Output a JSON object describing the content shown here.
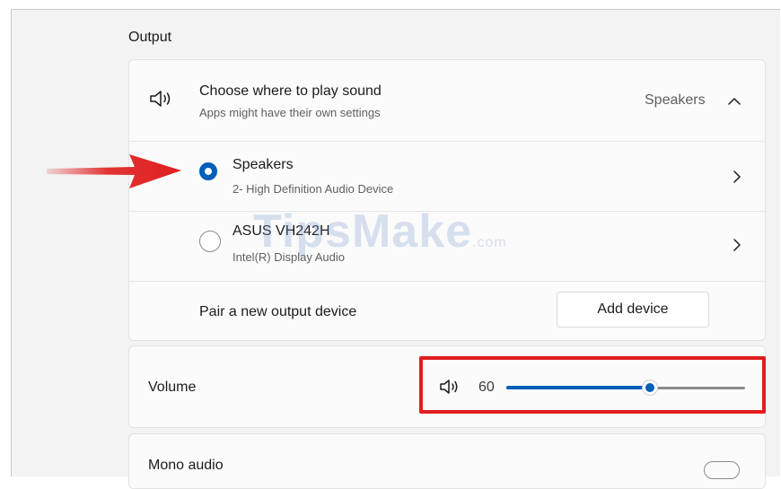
{
  "output": {
    "section_title": "Output",
    "header": {
      "title": "Choose where to play sound",
      "subtitle": "Apps might have their own settings",
      "current_device": "Speakers",
      "icon": "speaker-icon",
      "expand_icon": "chevron-up-icon"
    },
    "devices": [
      {
        "name": "Speakers",
        "description": "2- High Definition Audio Device",
        "selected": true
      },
      {
        "name": "ASUS VH242H",
        "description": "Intel(R) Display Audio",
        "selected": false
      }
    ],
    "pair": {
      "label": "Pair a new output device",
      "button_label": "Add device"
    }
  },
  "volume": {
    "label": "Volume",
    "value_text": "60",
    "value": 60,
    "icon": "speaker-icon"
  },
  "mono": {
    "label": "Mono audio"
  },
  "watermark": {
    "text": "TipsMake",
    "suffix": ".com"
  },
  "colors": {
    "accent": "#005fb8",
    "annotation_red": "#e01e1e",
    "card_bg": "#fbfbfb",
    "page_bg": "#f3f3f3"
  }
}
